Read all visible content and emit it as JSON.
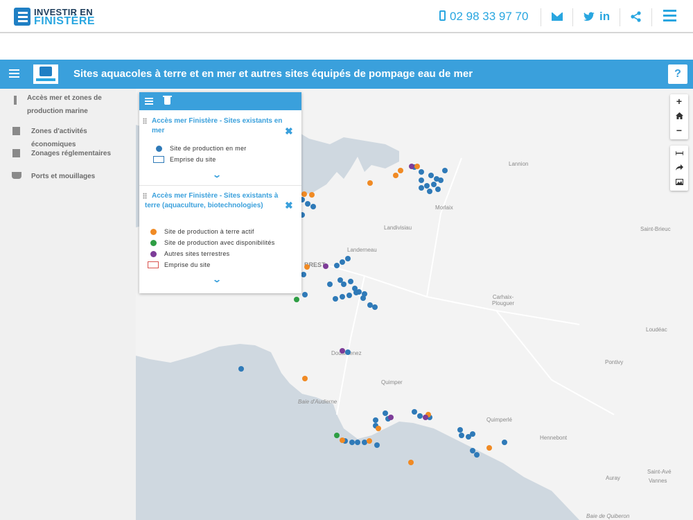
{
  "site_header": {
    "logo_line1": "INVESTIR EN",
    "logo_line2": "FINISTÈRE",
    "phone": "02 98 33 97 70",
    "icons": [
      "phone-icon",
      "envelope-icon",
      "twitter-icon",
      "linkedin-icon",
      "share-icon",
      "hamburger-menu-icon"
    ],
    "linkedin_text": "in",
    "accent_color": "#29a6e0"
  },
  "map_bar": {
    "title": "Sites aquacoles à terre et en mer et autres sites équipés de pompage eau de mer",
    "help_label": "?",
    "color": "#3aa0dc"
  },
  "sidebar": {
    "items": [
      {
        "icon": "info-icon",
        "label": "Accès mer et zones de production marine"
      },
      {
        "icon": "building-icon",
        "label": "Zones d'activités économiques"
      },
      {
        "icon": "book-icon",
        "label": "Zonages réglementaires"
      },
      {
        "icon": "ship-icon",
        "label": "Ports et mouillages"
      }
    ]
  },
  "legend": {
    "sections": [
      {
        "title": "Accès mer Finistère - Sites existants en mer",
        "items": [
          {
            "symbol": "dot",
            "color": "#2f7ab8",
            "label": "Site de production en mer"
          },
          {
            "symbol": "box",
            "color": "#2f7ab8",
            "label": "Emprise du site"
          }
        ]
      },
      {
        "title": "Accès mer Finistère - Sites existants à terre (aquaculture, biotechnologies)",
        "items": [
          {
            "symbol": "dot",
            "color": "#f08a24",
            "label": "Site de production à terre actif"
          },
          {
            "symbol": "dot",
            "color": "#2e9e44",
            "label": "Site de production avec disponibilités"
          },
          {
            "symbol": "dot",
            "color": "#7d3c98",
            "label": "Autres sites terrestres"
          },
          {
            "symbol": "box",
            "color": "#d9534f",
            "label": "Emprise du site"
          }
        ]
      }
    ]
  },
  "map_controls": {
    "zoom_in": "+",
    "zoom_out": "−",
    "icons": [
      "home-icon",
      "measure-icon",
      "share-arrow-icon",
      "image-icon"
    ]
  },
  "place_labels": [
    "Lannion",
    "Morlaix",
    "Landivisiau",
    "Saint-Brieuc",
    "Landerneau",
    "BREST",
    "Carhaix-Plouguer",
    "Loudéac",
    "Pontivy",
    "Douarnenez",
    "Quimper",
    "Baie d'Audierne",
    "Quimperlé",
    "Hennebont",
    "Auray",
    "Saint-Avé",
    "Vannes",
    "Baie de Quiberon"
  ]
}
